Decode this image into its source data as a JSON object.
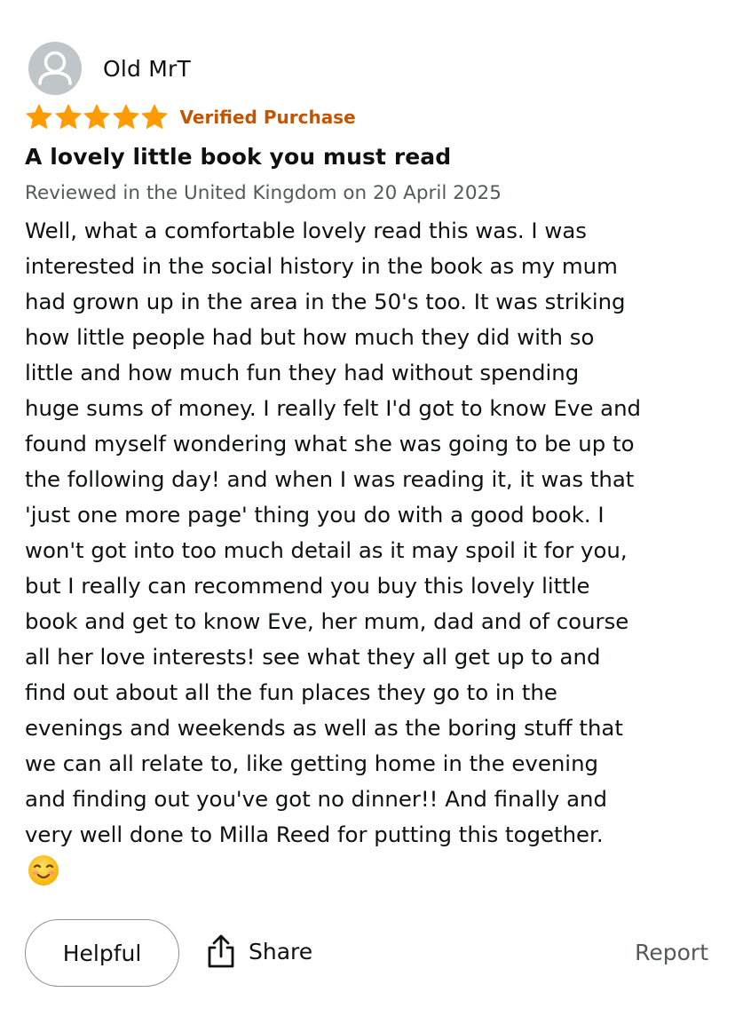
{
  "review": {
    "reviewer_name": "Old MrT",
    "rating": 5,
    "rating_max": 5,
    "verified_label": "Verified Purchase",
    "title": "A lovely little book you must read",
    "meta": "Reviewed in the United Kingdom on 20 April 2025",
    "body": "Well, what a comfortable lovely read this was. I was\ninterested in the social history in the book as my mum\nhad grown up in the area in the 50's too. It was striking\nhow little people had but how much they did with so\nlittle and how much fun they had without spending\nhuge sums of money. I really felt I'd got to know Eve and\nfound myself wondering what she was going to be up to\nthe following day! and when I was reading it, it was that\n'just one more page' thing you do with a good book. I\nwon't got into too much detail as it may spoil it for you,\nbut I really can recommend you buy this lovely little\nbook and get to know Eve, her mum, dad and of course\nall her love interests! see what they all get up to and\nfind out about all the fun places they go to in the\nevenings and weekends as well as the boring stuff that\nwe can all relate to, like getting home in the evening\nand finding out you've got no dinner!! And finally and\nvery well done to Milla Reed for putting this together.",
    "emoji_icon": "smiling-face-icon"
  },
  "actions": {
    "helpful_label": "Helpful",
    "share_label": "Share",
    "share_icon": "share-icon",
    "report_label": "Report"
  },
  "colors": {
    "star": "#ff9a00",
    "verified": "#c45500",
    "meta_text": "#565959",
    "body_text": "#0f1111",
    "avatar_bg": "#c0c5ca",
    "button_border": "#8d9096"
  }
}
